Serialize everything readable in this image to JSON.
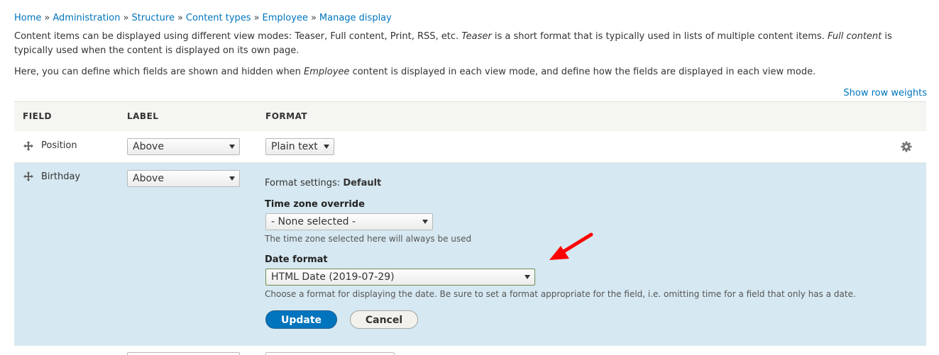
{
  "breadcrumb": {
    "items": [
      "Home",
      "Administration",
      "Structure",
      "Content types",
      "Employee",
      "Manage display"
    ],
    "separator": "»"
  },
  "intro": {
    "p1_a": "Content items can be displayed using different view modes: Teaser, Full content, Print, RSS, etc. ",
    "p1_teaser": "Teaser",
    "p1_b": " is a short format that is typically used in lists of multiple content items. ",
    "p1_full": "Full content",
    "p1_c": " is typically used when the content is displayed on its own page.",
    "p2_a": "Here, you can define which fields are shown and hidden when ",
    "p2_type": "Employee",
    "p2_b": " content is displayed in each view mode, and define how the fields are displayed in each view mode."
  },
  "show_row_weights": "Show row weights",
  "table": {
    "headers": {
      "field": "FIELD",
      "label": "LABEL",
      "format": "FORMAT"
    },
    "rows": [
      {
        "field": "Position",
        "label_value": "Above",
        "format_value": "Plain text"
      },
      {
        "field": "Birthday",
        "label_value": "Above"
      }
    ]
  },
  "format_settings": {
    "prefix": "Format settings:",
    "name": "Default",
    "timezone_label": "Time zone override",
    "timezone_value": "- None selected -",
    "timezone_desc": "The time zone selected here will always be used",
    "date_format_label": "Date format",
    "date_format_value": "HTML Date (2019-07-29)",
    "date_format_desc": "Choose a format for displaying the date. Be sure to set a format appropriate for the field, i.e. omitting time for a field that only has a date.",
    "update_label": "Update",
    "cancel_label": "Cancel"
  },
  "colors": {
    "link": "#0074bd",
    "active_row": "#d6e8f1",
    "primary_button": "#0074bd",
    "annotation_arrow": "#ff0000"
  },
  "icons": [
    "move-handle-icon",
    "gear-icon",
    "chevron-down-icon",
    "red-arrow-annotation"
  ]
}
